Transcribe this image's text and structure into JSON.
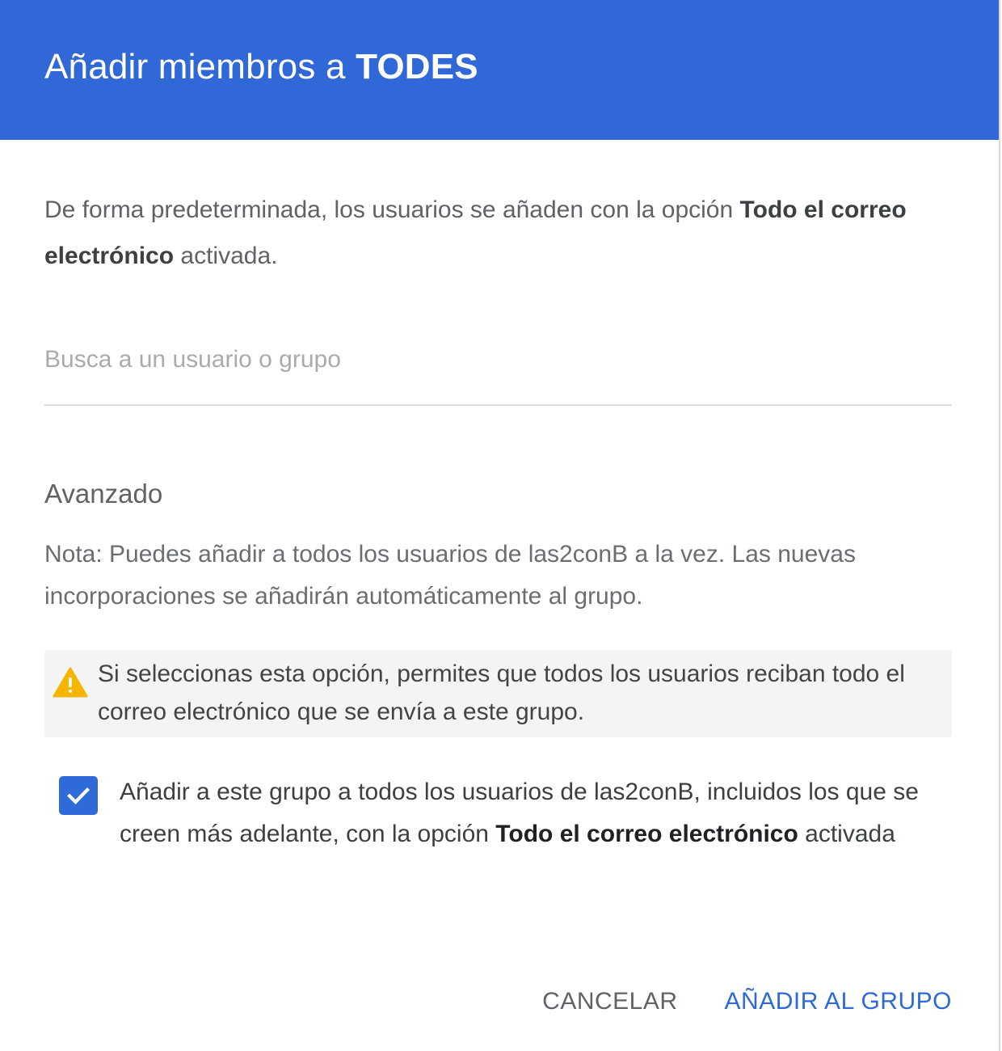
{
  "dialog": {
    "title_prefix": "Añadir miembros a ",
    "title_group": "TODES"
  },
  "intro": {
    "text_before": "De forma predeterminada, los usuarios se añaden con la opción ",
    "bold": "Todo el correo electrónico",
    "text_after": " activada."
  },
  "search": {
    "placeholder": "Busca a un usuario o grupo",
    "value": ""
  },
  "advanced": {
    "title": "Avanzado",
    "note": "Nota: Puedes añadir a todos los usuarios de las2conB a la vez. Las nuevas incorporaciones se añadirán automáticamente al grupo.",
    "warning": {
      "icon": "warning-icon",
      "text": "Si seleccionas esta opción, permites que todos los usuarios reciban todo el correo electrónico que se envía a este grupo."
    },
    "checkbox": {
      "checked": true,
      "label_before": "Añadir a este grupo a todos los usuarios de las2conB, incluidos los que se creen más adelante, con la opción ",
      "label_bold": "Todo el correo electrónico",
      "label_after": " activada"
    }
  },
  "actions": {
    "cancel_label": "CANCELAR",
    "confirm_label": "AÑADIR AL GRUPO"
  },
  "colors": {
    "header": "#3069d7",
    "primary": "#2e6ad6",
    "checkbox": "#2f6bd8",
    "warning_icon": "#f6b600",
    "warning_bg": "#f4f4f4"
  }
}
